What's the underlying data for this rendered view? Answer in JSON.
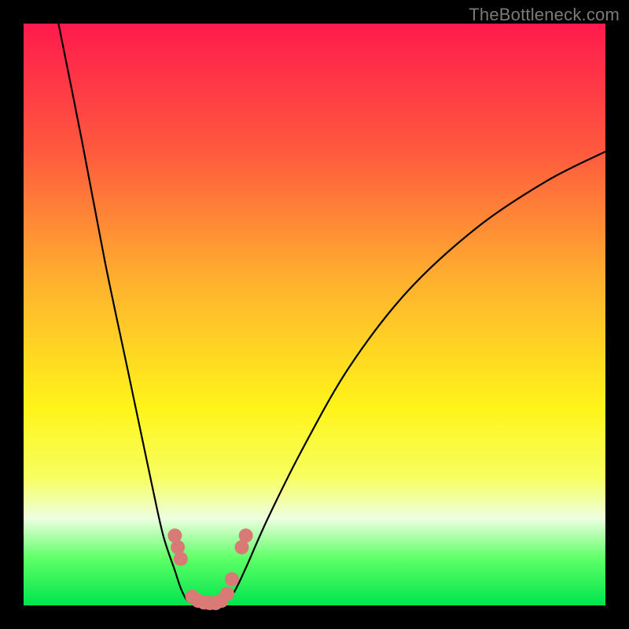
{
  "watermark": "TheBottleneck.com",
  "chart_data": {
    "type": "line",
    "title": "",
    "xlabel": "",
    "ylabel": "",
    "xlim": [
      0,
      100
    ],
    "ylim": [
      0,
      100
    ],
    "grid": false,
    "legend": "none",
    "series": [
      {
        "name": "left-curve",
        "x": [
          6,
          10,
          14,
          18,
          22,
          24,
          26,
          27,
          28,
          29,
          30
        ],
        "y": [
          100,
          80,
          59,
          40,
          21,
          12,
          6,
          3,
          1,
          0.4,
          0
        ]
      },
      {
        "name": "right-curve",
        "x": [
          34,
          36,
          38,
          42,
          48,
          56,
          66,
          78,
          90,
          100
        ],
        "y": [
          0,
          2,
          6,
          15,
          27,
          41,
          54,
          65,
          73,
          78
        ]
      }
    ],
    "markers": {
      "name": "salmon-dots",
      "color": "#d97a76",
      "points": [
        {
          "x": 26.0,
          "y": 12.0
        },
        {
          "x": 26.5,
          "y": 10.0
        },
        {
          "x": 27.0,
          "y": 8.0
        },
        {
          "x": 29.0,
          "y": 1.5
        },
        {
          "x": 30.0,
          "y": 0.8
        },
        {
          "x": 31.0,
          "y": 0.5
        },
        {
          "x": 32.0,
          "y": 0.4
        },
        {
          "x": 33.0,
          "y": 0.4
        },
        {
          "x": 34.0,
          "y": 0.8
        },
        {
          "x": 35.0,
          "y": 2.0
        },
        {
          "x": 35.8,
          "y": 4.5
        },
        {
          "x": 37.5,
          "y": 10.0
        },
        {
          "x": 38.2,
          "y": 12.0
        }
      ]
    },
    "gradient_stops": [
      {
        "pos": 0.0,
        "color": "#ff1a4d"
      },
      {
        "pos": 0.22,
        "color": "#ff5a3e"
      },
      {
        "pos": 0.44,
        "color": "#ffb02f"
      },
      {
        "pos": 0.66,
        "color": "#fff41a"
      },
      {
        "pos": 0.78,
        "color": "#f7ff60"
      },
      {
        "pos": 0.85,
        "color": "#edffe0"
      },
      {
        "pos": 0.92,
        "color": "#5dff66"
      },
      {
        "pos": 1.0,
        "color": "#00e54f"
      }
    ]
  }
}
